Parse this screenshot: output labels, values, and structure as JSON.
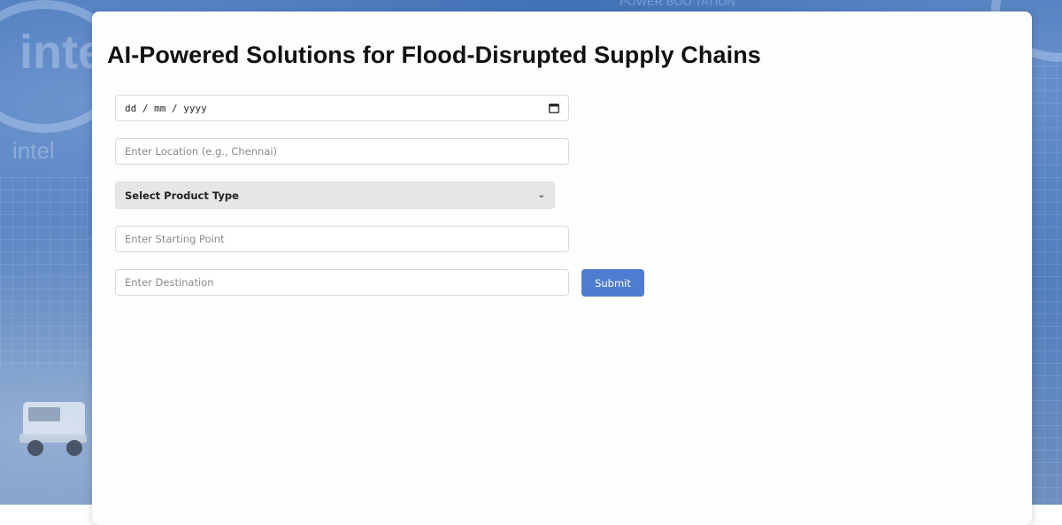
{
  "page": {
    "title": "AI-Powered Solutions for Flood-Disrupted Supply Chains"
  },
  "form": {
    "date_placeholder": "dd / mm / yyyy",
    "location_placeholder": "Enter Location (e.g., Chennai)",
    "product_select_value": "Select Product Type",
    "start_placeholder": "Enter Starting Point",
    "destination_placeholder": "Enter Destination",
    "submit_label": "Submit"
  },
  "background": {
    "brand_text_1": "intel",
    "brand_text_2": "intel",
    "banner_text": "POWER BOO   TATION"
  },
  "colors": {
    "accent": "#4e7cd0",
    "panel": "#fdfdfc",
    "select_bg": "#e6e6e6"
  }
}
